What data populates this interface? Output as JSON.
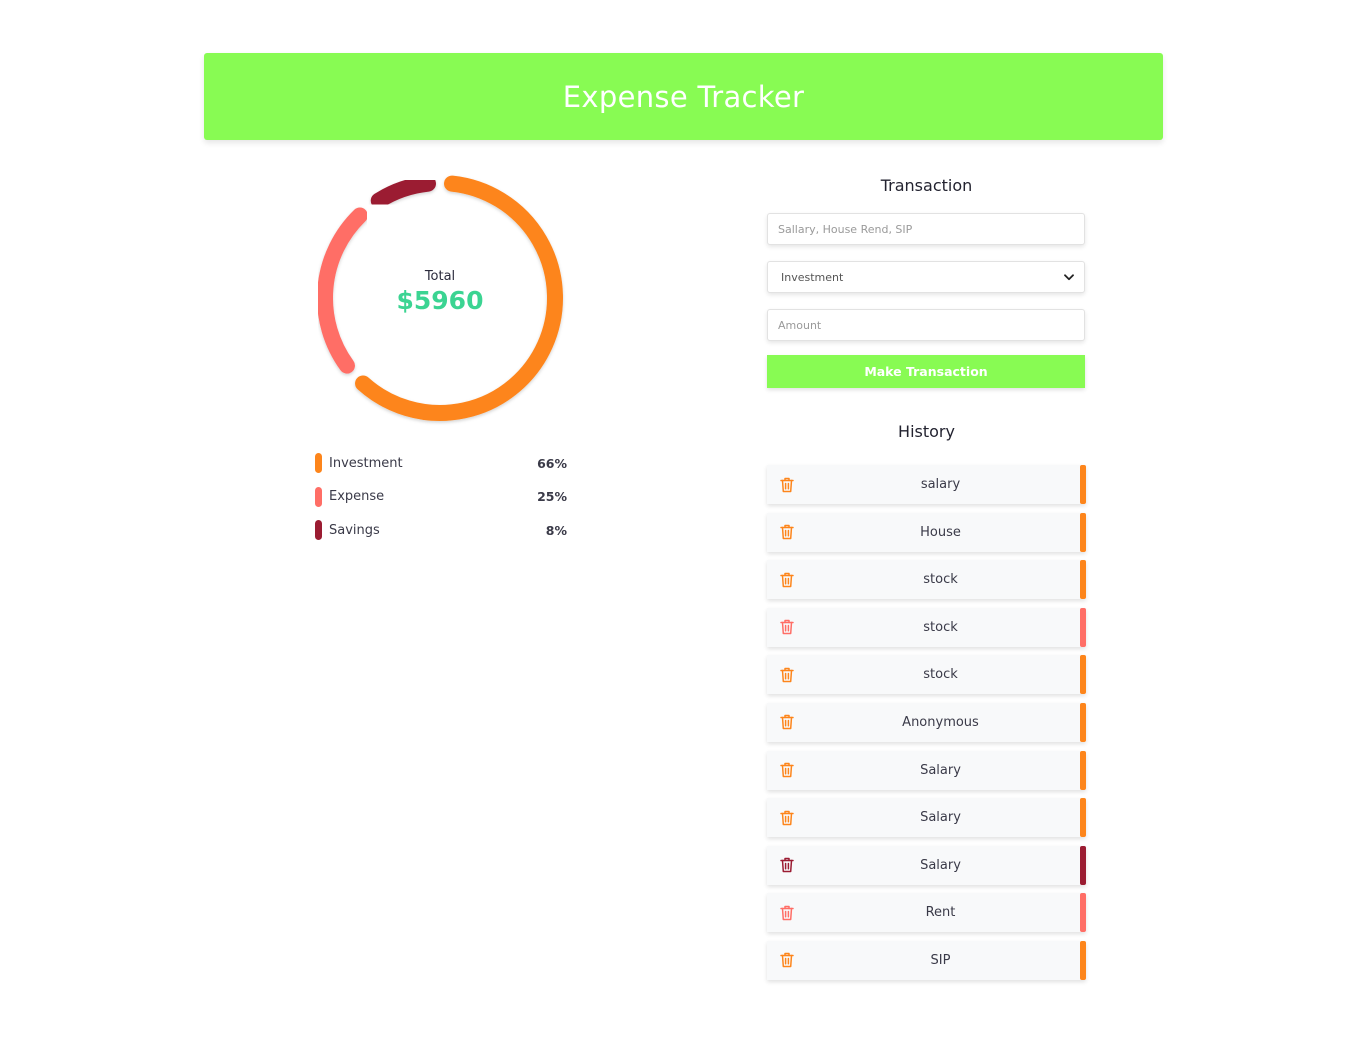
{
  "header": {
    "title": "Expense Tracker"
  },
  "summary": {
    "total_label": "Total",
    "total_value": "$5960"
  },
  "categories": [
    {
      "name": "Investment",
      "percent": "66%",
      "value": 66,
      "color": "#fd851b"
    },
    {
      "name": "Expense",
      "percent": "25%",
      "value": 25,
      "color": "#ff6e66"
    },
    {
      "name": "Savings",
      "percent": "8%",
      "value": 8,
      "color": "#9b1c32"
    }
  ],
  "transaction": {
    "title": "Transaction",
    "description_placeholder": "Sallary, House Rend, SIP",
    "type_selected": "Investment",
    "amount_placeholder": "Amount",
    "submit_label": "Make Transaction"
  },
  "history": {
    "title": "History",
    "items": [
      {
        "name": "salary",
        "color": "#fd851b"
      },
      {
        "name": "House",
        "color": "#fd851b"
      },
      {
        "name": "stock",
        "color": "#fd851b"
      },
      {
        "name": "stock",
        "color": "#ff6e66"
      },
      {
        "name": "stock",
        "color": "#fd851b"
      },
      {
        "name": "Anonymous",
        "color": "#fd851b"
      },
      {
        "name": "Salary",
        "color": "#fd851b"
      },
      {
        "name": "Salary",
        "color": "#fd851b"
      },
      {
        "name": "Salary",
        "color": "#9b1c32"
      },
      {
        "name": "Rent",
        "color": "#ff6e66"
      },
      {
        "name": "SIP",
        "color": "#fd851b"
      }
    ]
  }
}
